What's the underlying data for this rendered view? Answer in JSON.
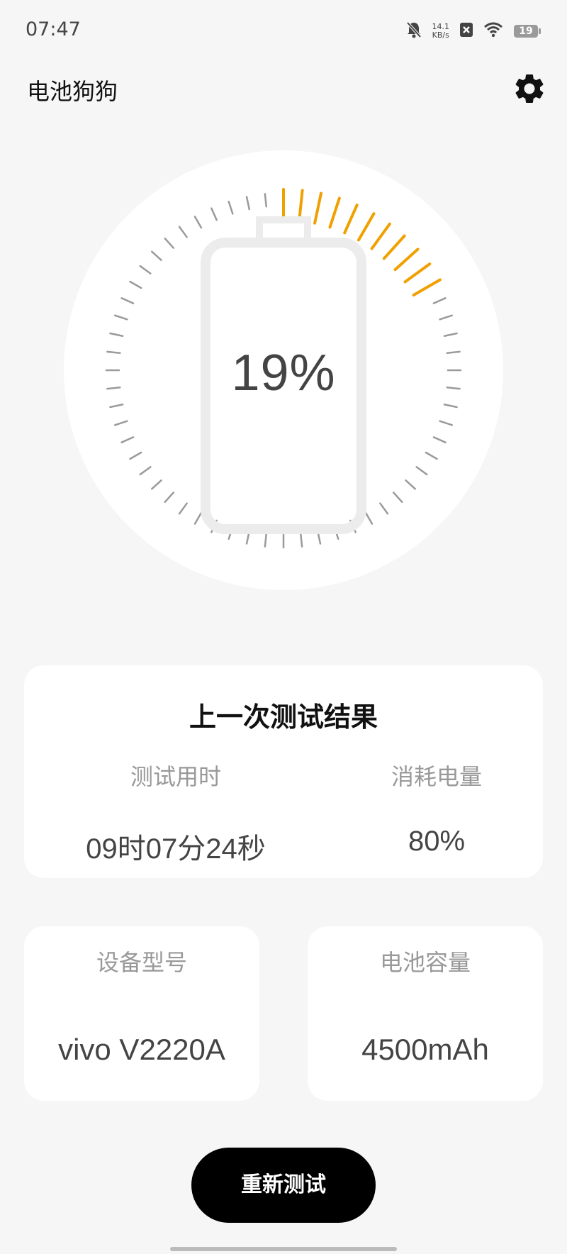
{
  "status_bar": {
    "time": "07:47",
    "net_speed_value": "14.1",
    "net_speed_unit": "KB/s",
    "battery_level": "19",
    "icons": [
      "bell-off-icon",
      "close-box-icon",
      "wifi-icon",
      "battery-icon"
    ]
  },
  "app": {
    "title": "电池狗狗",
    "settings_icon": "gear-icon"
  },
  "gauge": {
    "percent_label": "19%",
    "level": 19,
    "accent_color": "#f0a000",
    "tick_color": "#9a9a9a"
  },
  "last_result": {
    "title": "上一次测试结果",
    "duration_label": "测试用时",
    "duration_value": "09时07分24秒",
    "consumed_label": "消耗电量",
    "consumed_value": "80%"
  },
  "device": {
    "model_label": "设备型号",
    "model_value": "vivo V2220A",
    "capacity_label": "电池容量",
    "capacity_value": "4500mAh"
  },
  "actions": {
    "retest_label": "重新测试"
  }
}
